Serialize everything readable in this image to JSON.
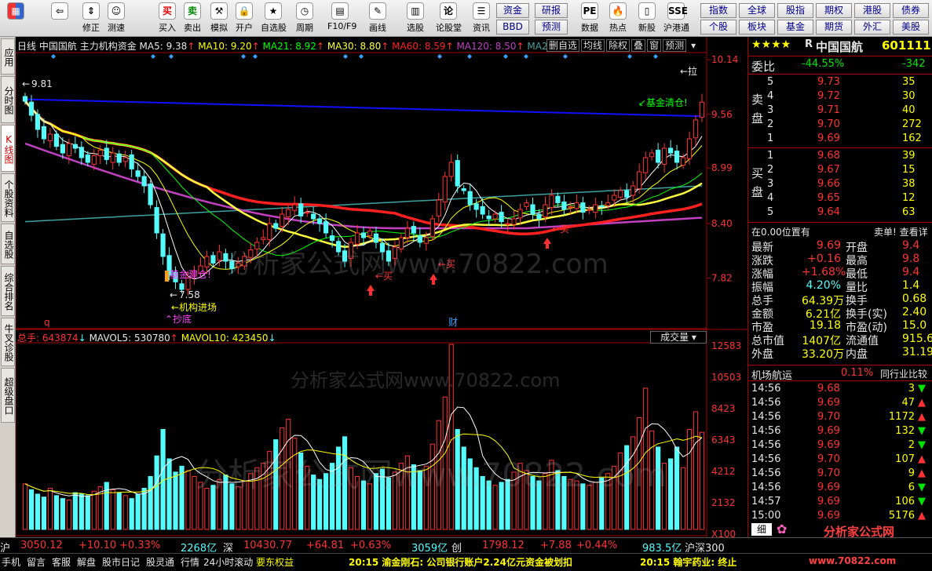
{
  "toolbar": {
    "buttons": [
      {
        "label": "",
        "icon": "grid-icon",
        "glyph": "▦"
      },
      {
        "label": "",
        "icon": "back-arrow-icon",
        "glyph": "⇦"
      },
      {
        "label": "修正",
        "icon": "up-down-icon",
        "glyph": "⇕"
      },
      {
        "label": "测速",
        "icon": "speed-icon",
        "glyph": "☺"
      },
      {
        "label": "买入",
        "icon": "buy-icon",
        "glyph": "买"
      },
      {
        "label": "卖出",
        "icon": "sell-icon",
        "glyph": "卖"
      },
      {
        "label": "模拟",
        "icon": "hammer-icon",
        "glyph": "⚒"
      },
      {
        "label": "开户",
        "icon": "lock-icon",
        "glyph": "🔒"
      },
      {
        "label": "自选股",
        "icon": "star-icon",
        "glyph": "★"
      },
      {
        "label": "周期",
        "icon": "clock-icon",
        "glyph": "◷"
      },
      {
        "label": "F10/F9",
        "icon": "f10-icon",
        "glyph": "▤"
      },
      {
        "label": "画线",
        "icon": "pencil-icon",
        "glyph": "✎"
      },
      {
        "label": "选股",
        "icon": "chart-icon",
        "glyph": "▥"
      },
      {
        "label": "论股堂",
        "icon": "lun-icon",
        "glyph": "论"
      },
      {
        "label": "资讯",
        "icon": "news-icon",
        "glyph": "☰"
      },
      {
        "label": "数据",
        "icon": "pdf-icon",
        "glyph": "PE"
      },
      {
        "label": "热点",
        "icon": "fire-icon",
        "glyph": "🔥"
      },
      {
        "label": "新股",
        "icon": "new-stock-icon",
        "glyph": "▯"
      },
      {
        "label": "沪港通",
        "icon": "hk-icon",
        "glyph": "SSE"
      }
    ],
    "small_buttons": [
      "资金",
      "研报",
      "BBD",
      "预测"
    ],
    "right_buttons": [
      "指数",
      "全球",
      "股指",
      "期权",
      "港股",
      "债券",
      "个股",
      "板块",
      "基金",
      "期货",
      "外汇",
      "美股"
    ]
  },
  "left_tabs": [
    "应用",
    "分时图",
    "K线图",
    "个股资料",
    "自选股",
    "综合排名",
    "牛叉诊股",
    "超级盘口"
  ],
  "chart_header": {
    "period": "日线",
    "name": "中国国航",
    "indicator": "主力机构资金",
    "ma5": "MA5: 9.38",
    "ma10": "MA10: 9.20",
    "ma21": "MA21: 8.92",
    "ma30": "MA30: 8.80",
    "ma60": "MA60: 8.59",
    "ma120": "MA120: 8.50",
    "ma250": "MA250: 8",
    "tools": [
      "删自选",
      "均线",
      "除权",
      "叠",
      "窗",
      "预测"
    ]
  },
  "price_axis": [
    "10.14",
    "9.56",
    "8.99",
    "8.40",
    "7.82"
  ],
  "annotations": {
    "high": "9.81",
    "low": "7.58",
    "fund_exit": "基金清仓!",
    "fund_build": "基金建仓!",
    "inst_in": "机构进场",
    "bottom": "抄底",
    "buy": "买",
    "right_marker": "拉",
    "q_marker": "q",
    "cai_marker": "财"
  },
  "volume_header": {
    "total": "总手: 643874",
    "mavol5": "MAVOL5: 530780",
    "mavol10": "MAVOL10: 423450",
    "label": "成交量"
  },
  "volume_axis": [
    "12583",
    "10503",
    "8423",
    "6343",
    "4212",
    "2132",
    "X100"
  ],
  "watermark": "分析家公式网www.70822.com",
  "chart_data": {
    "type": "candlestick",
    "title": "中国国航",
    "y_range": [
      7.3,
      10.2
    ],
    "volume_range": [
      0,
      12583
    ],
    "moving_averages": [
      {
        "name": "MA5",
        "last": 9.38,
        "color": "#ffffff"
      },
      {
        "name": "MA10",
        "last": 9.2,
        "color": "#ffff00"
      },
      {
        "name": "MA21",
        "last": 8.92,
        "color": "#00ff00"
      },
      {
        "name": "MA30",
        "last": 8.8,
        "color": "#ffff40"
      },
      {
        "name": "MA60",
        "last": 8.59,
        "color": "#ff2020"
      },
      {
        "name": "MA120",
        "last": 8.5,
        "color": "#c040c0"
      },
      {
        "name": "MA250",
        "last": 8.0,
        "color": "#40a0a0"
      }
    ],
    "closes": [
      9.7,
      9.55,
      9.4,
      9.3,
      9.35,
      9.22,
      9.15,
      9.25,
      9.2,
      9.1,
      9.05,
      9.12,
      9.18,
      9.08,
      9.15,
      9.05,
      9.1,
      8.98,
      8.9,
      8.8,
      8.6,
      8.3,
      8.05,
      7.85,
      7.78,
      7.7,
      7.82,
      7.9,
      7.95,
      8.05,
      7.98,
      8.1,
      8.0,
      7.92,
      7.98,
      8.05,
      8.12,
      8.2,
      8.25,
      8.4,
      8.35,
      8.5,
      8.55,
      8.6,
      8.48,
      8.52,
      8.45,
      8.4,
      8.3,
      8.22,
      8.1,
      8.0,
      8.2,
      8.3,
      8.25,
      8.32,
      8.2,
      8.1,
      8.0,
      8.15,
      8.25,
      8.35,
      8.3,
      8.2,
      8.25,
      8.45,
      8.65,
      8.9,
      9.05,
      8.8,
      8.75,
      8.6,
      8.55,
      8.5,
      8.45,
      8.5,
      8.42,
      8.4,
      8.45,
      8.55,
      8.62,
      8.5,
      8.45,
      8.6,
      8.7,
      8.62,
      8.55,
      8.58,
      8.62,
      8.52,
      8.55,
      8.6,
      8.58,
      8.62,
      8.7,
      8.75,
      8.68,
      8.8,
      8.95,
      9.1,
      9.15,
      9.05,
      9.2,
      9.15,
      9.05,
      9.1,
      9.3,
      9.5,
      9.69
    ],
    "volumes": [
      3100,
      2700,
      2400,
      2200,
      2800,
      2300,
      2100,
      2000,
      2500,
      2400,
      2300,
      2600,
      2900,
      3200,
      2700,
      2500,
      2300,
      2100,
      2400,
      2800,
      3600,
      5000,
      6800,
      4800,
      3900,
      4300,
      4000,
      3600,
      3200,
      2800,
      3000,
      3400,
      3700,
      3100,
      2900,
      3300,
      3800,
      4200,
      4500,
      5300,
      6100,
      6900,
      7500,
      6200,
      5200,
      4300,
      3700,
      3400,
      3800,
      4500,
      5600,
      6300,
      4200,
      3600,
      3300,
      3100,
      3800,
      4100,
      3500,
      3900,
      4500,
      5000,
      4400,
      4000,
      4300,
      5800,
      7400,
      9000,
      12583,
      6800,
      5600,
      4800,
      4200,
      3600,
      3300,
      3000,
      3200,
      3400,
      3900,
      4500,
      4000,
      3600,
      3300,
      3800,
      4700,
      4000,
      3600,
      3400,
      3300,
      3100,
      3000,
      3200,
      3500,
      3800,
      4300,
      5200,
      5700,
      6300,
      7600,
      9600,
      6700,
      5600,
      4500,
      4800,
      5600,
      4200,
      6800,
      8000,
      6600
    ]
  },
  "quote": {
    "stars": "★★★★",
    "tag": "R",
    "name": "中国国航",
    "code": "601111",
    "weibi_label": "委比",
    "weibi": "-44.55%",
    "weicha": "-342",
    "sell_label": "卖盘",
    "buy_label": "买盘",
    "asks": [
      {
        "lvl": "5",
        "price": "9.73",
        "vol": "35"
      },
      {
        "lvl": "4",
        "price": "9.72",
        "vol": "30"
      },
      {
        "lvl": "3",
        "price": "9.71",
        "vol": "40"
      },
      {
        "lvl": "2",
        "price": "9.70",
        "vol": "272"
      },
      {
        "lvl": "1",
        "price": "9.69",
        "vol": "162"
      }
    ],
    "bids": [
      {
        "lvl": "1",
        "price": "9.68",
        "vol": "39"
      },
      {
        "lvl": "2",
        "price": "9.67",
        "vol": "15"
      },
      {
        "lvl": "3",
        "price": "9.66",
        "vol": "38"
      },
      {
        "lvl": "4",
        "price": "9.65",
        "vol": "12"
      },
      {
        "lvl": "5",
        "price": "9.64",
        "vol": "63"
      }
    ],
    "position_note": "在0.00位置有",
    "sell_note": "卖单! 查看详",
    "stats": [
      {
        "k1": "最新",
        "v1": "9.69",
        "k2": "开盘",
        "v2": "9.4"
      },
      {
        "k1": "涨跌",
        "v1": "+0.16",
        "k2": "最高",
        "v2": "9.8"
      },
      {
        "k1": "涨幅",
        "v1": "+1.68%",
        "k2": "最低",
        "v2": "9.4"
      },
      {
        "k1": "振幅",
        "v1": "4.20%",
        "k2": "量比",
        "v2": "1.4"
      },
      {
        "k1": "总手",
        "v1": "64.39万",
        "k2": "换手",
        "v2": "0.68"
      },
      {
        "k1": "金额",
        "v1": "6.21亿",
        "k2": "换手(实)",
        "v2": "2.40"
      },
      {
        "k1": "市盈",
        "v1": "19.18",
        "k2": "市盈(动)",
        "v2": "15.0"
      },
      {
        "k1": "总市值",
        "v1": "1407亿",
        "k2": "流通值",
        "v2": "915.6"
      },
      {
        "k1": "外盘",
        "v1": "33.20万",
        "k2": "内盘",
        "v2": "31.19"
      }
    ],
    "sector": "机场航运",
    "sector_chg": "0.11%",
    "sector_link": "同行业比较",
    "ticks": [
      {
        "t": "14:56",
        "p": "9.68",
        "v": "3",
        "dir": "down"
      },
      {
        "t": "14:56",
        "p": "9.69",
        "v": "47",
        "dir": "up"
      },
      {
        "t": "14:56",
        "p": "9.70",
        "v": "1172",
        "dir": "up"
      },
      {
        "t": "14:56",
        "p": "9.69",
        "v": "132",
        "dir": "down"
      },
      {
        "t": "14:56",
        "p": "9.69",
        "v": "2",
        "dir": "down"
      },
      {
        "t": "14:56",
        "p": "9.70",
        "v": "107",
        "dir": "up"
      },
      {
        "t": "14:56",
        "p": "9.70",
        "v": "9",
        "dir": "up"
      },
      {
        "t": "14:56",
        "p": "9.69",
        "v": "6",
        "dir": "down"
      },
      {
        "t": "14:57",
        "p": "9.69",
        "v": "106",
        "dir": "down"
      },
      {
        "t": "15:00",
        "p": "9.69",
        "v": "5176",
        "dir": "up"
      }
    ],
    "bottom_tab": "细"
  },
  "status": {
    "sh_label": "沪",
    "sh_index": "3050.12",
    "sh_chg": "+10.10",
    "sh_pct": "+0.33%",
    "sh_amt": "2268亿",
    "sz_label": "深",
    "sz_index": "10430.77",
    "sz_chg": "+64.81",
    "sz_pct": "+0.63%",
    "sz_amt": "3059亿",
    "cy_label": "创",
    "cy_index": "1798.12",
    "cy_chg": "+7.88",
    "cy_pct": "+0.44%",
    "hs_amt": "983.5亿",
    "hs_label": "沪深300",
    "tabs": [
      "手机",
      "留言",
      "客服",
      "解盘",
      "股市日记",
      "股灵通",
      "行情",
      "24小时滚动",
      "要东权益"
    ],
    "news1": "20:15 渝金刚石: 公司银行账户2.24亿元资金被划扣",
    "news2": "20:15 翰宇药业: 终止",
    "logo": "分析家公式网",
    "logo_url": "www.70822.com"
  }
}
